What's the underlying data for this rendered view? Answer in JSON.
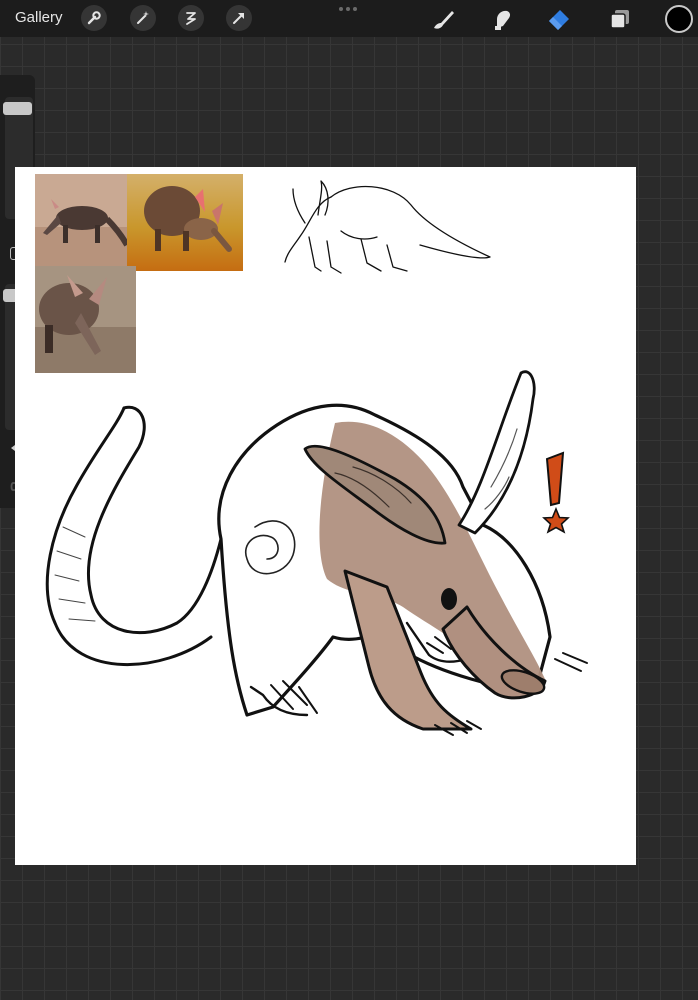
{
  "toolbar": {
    "gallery_label": "Gallery",
    "left_tools": [
      "wrench-icon",
      "magic-wand-icon",
      "selection-icon",
      "transform-arrow-icon"
    ],
    "right_tools": [
      "brush-icon",
      "smudge-icon",
      "eraser-icon",
      "layers-icon"
    ],
    "active_tool": "eraser",
    "accent_color": "#2f7de1",
    "current_color": "#000000"
  },
  "sidebar": {
    "brush_size_level": 0.95,
    "opacity_level": 0.97,
    "buttons": [
      "modify-button",
      "undo-icon",
      "redo-icon"
    ]
  },
  "canvas": {
    "background": "#ffffff",
    "references": [
      "aardvark-photo-walking",
      "aardvark-photo-sand",
      "aardvark-photo-closeup"
    ],
    "sketches": [
      "aardvark-reference-line-sketch",
      "aardvark-main-drawing",
      "exclamation-star-mark"
    ],
    "colors": {
      "fur": "#b09080",
      "ear": "#a08878",
      "exclamation": "#d04c18"
    }
  }
}
